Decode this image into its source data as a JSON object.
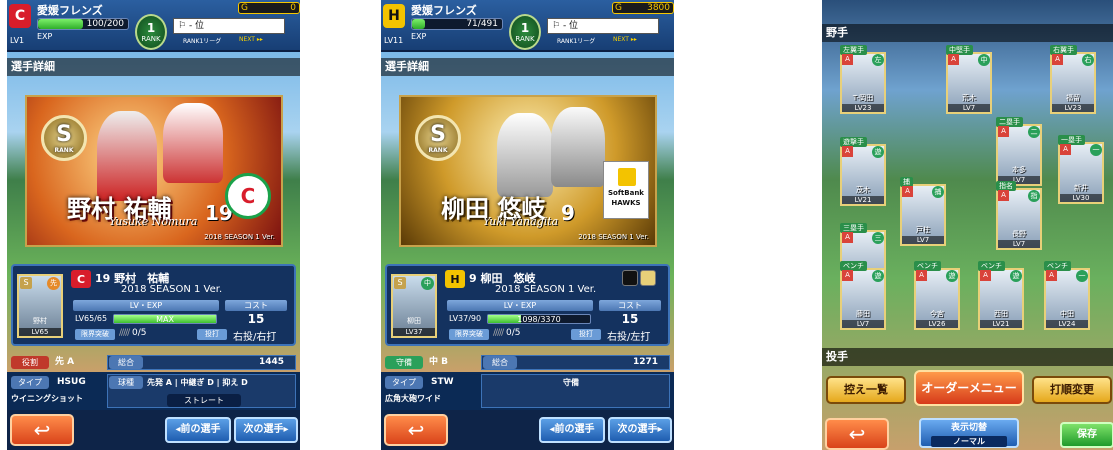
{
  "phones": [
    {
      "team_name": "愛媛フレンズ",
      "level": "LV1",
      "exp": "100/200",
      "exp_fraction": 0.5,
      "coin": "0",
      "rank_label": "RANK",
      "rank_num": "1",
      "rank_value": "- 位",
      "rank_league": "RANK1リーグ",
      "next": "NEXT ▸▸",
      "section": "選手詳細",
      "card_name": "野村 祐輔",
      "card_roman": "Yusuke Nomura",
      "card_number": "19",
      "card_season": "2018 SEASON 1 Ver.",
      "rank_s": "S",
      "rank_s_label": "RANK",
      "info_name": "19 野村　祐輔",
      "info_version": "2018 SEASON 1 Ver.",
      "lv_exp_header": "LV・EXP",
      "cost_header": "コスト",
      "lv_value": "LV65/65",
      "lv_bar_text": "MAX",
      "lv_fraction": 1.0,
      "cost_value": "15",
      "limit_label": "限界突破",
      "limit_value": "0/5",
      "throw_label": "投打",
      "throw_value": "右投/右打",
      "thumb_name": "野村",
      "thumb_lv": "LV65",
      "thumb_pos": "先",
      "role_label": "役割",
      "role_value": "先 A",
      "power_label": "総合",
      "power_value": "1445",
      "type_label": "タイプ",
      "type_value": "HSUG",
      "pitch_label": "球種",
      "pitch_values": "先発 A | 中継ぎ D | 抑え D",
      "ability_text": "ウイニングショット",
      "pitch_sub": "ストレート",
      "prev_button": "◂前の選手",
      "next_button": "次の選手▸",
      "back_icon": "↩"
    },
    {
      "team_name": "愛媛フレンズ",
      "level": "LV11",
      "exp": "71/491",
      "exp_fraction": 0.145,
      "coin": "3800",
      "rank_label": "RANK",
      "rank_num": "1",
      "rank_value": "- 位",
      "rank_league": "RANK1リーグ",
      "next": "NEXT ▸▸",
      "section": "選手詳細",
      "card_name": "柳田 悠岐",
      "card_roman": "Yuki Yanagita",
      "card_number": "9",
      "card_season": "2018 SEASON 1 Ver.",
      "rank_s": "S",
      "rank_s_label": "RANK",
      "info_name": "9 柳田　悠岐",
      "info_version": "2018 SEASON 1 Ver.",
      "lv_exp_header": "LV・EXP",
      "cost_header": "コスト",
      "lv_value": "LV37/90",
      "lv_bar_text": "1098/3370",
      "lv_fraction": 0.326,
      "cost_value": "15",
      "limit_label": "限界突破",
      "limit_value": "0/5",
      "throw_label": "投打",
      "throw_value": "右投/左打",
      "thumb_name": "柳田",
      "thumb_lv": "LV37",
      "thumb_pos": "中",
      "role_label": "守備",
      "role_value": "中 B",
      "power_label": "総合",
      "power_value": "1271",
      "type_label": "タイプ",
      "type_value": "STW",
      "pitch_label": "守備",
      "pitch_values": "",
      "ability_text": "広角大砲ワイド",
      "pitch_sub": "",
      "hawks_text": "SoftBank HAWKS",
      "prev_button": "◂前の選手",
      "next_button": "次の選手▸",
      "back_icon": "↩"
    }
  ],
  "lineup": {
    "header": "野手",
    "pitcher_header": "投手",
    "players": [
      {
        "pos": "左翼手",
        "name": "T-岡田",
        "lv": "LV23",
        "hand": "左"
      },
      {
        "pos": "中堅手",
        "name": "荒木",
        "lv": "LV7",
        "hand": "中"
      },
      {
        "pos": "右翼手",
        "name": "福留",
        "lv": "LV23",
        "hand": "右"
      },
      {
        "pos": "遊撃手",
        "name": "茂木",
        "lv": "LV21",
        "hand": "遊"
      },
      {
        "pos": "二塁手",
        "name": "本多",
        "lv": "LV7",
        "hand": "二"
      },
      {
        "pos": "三塁手",
        "name": "西",
        "lv": "LV7",
        "hand": "三"
      },
      {
        "pos": "一塁手",
        "name": "新井",
        "lv": "LV30",
        "hand": "一"
      },
      {
        "pos": "捕",
        "name": "戸柱",
        "lv": "LV7",
        "hand": "捕"
      },
      {
        "pos": "指名",
        "name": "長野",
        "lv": "LV7",
        "hand": "指"
      },
      {
        "pos": "ベンチ",
        "name": "藤田",
        "lv": "LV7",
        "hand": "遊"
      },
      {
        "pos": "ベンチ",
        "name": "今宮",
        "lv": "LV26",
        "hand": "遊"
      },
      {
        "pos": "ベンチ",
        "name": "西田",
        "lv": "LV21",
        "hand": "遊"
      },
      {
        "pos": "ベンチ",
        "name": "中田",
        "lv": "LV24",
        "hand": "一"
      }
    ],
    "buttons": {
      "bench": "控え一覧",
      "order": "オーダーメニュー",
      "batting": "打順変更",
      "display": "表示切替",
      "display_mode": "ノーマル",
      "save": "保存",
      "back_icon": "↩"
    }
  }
}
